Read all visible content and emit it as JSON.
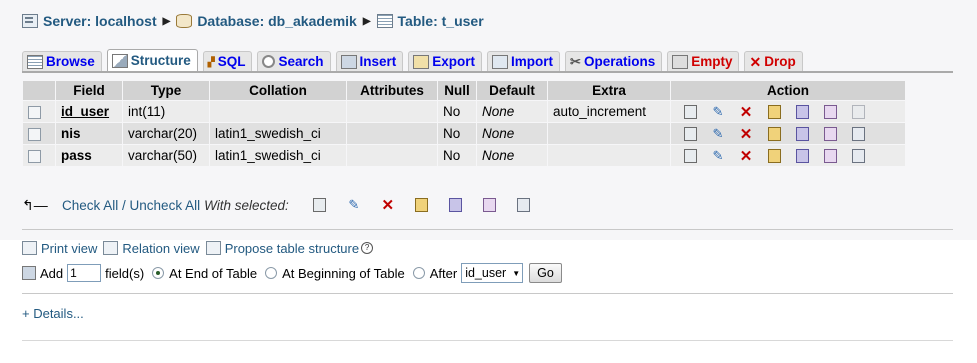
{
  "breadcrumb": {
    "server_label": "Server: localhost",
    "database_label": "Database: db_akademik",
    "table_label": "Table: t_user",
    "separator": "▶"
  },
  "tabs": [
    {
      "label": "Browse",
      "icon": "browse-icon"
    },
    {
      "label": "Structure",
      "icon": "structure-icon",
      "active": true
    },
    {
      "label": "SQL",
      "icon": "sql-icon"
    },
    {
      "label": "Search",
      "icon": "search-icon"
    },
    {
      "label": "Insert",
      "icon": "insert-icon"
    },
    {
      "label": "Export",
      "icon": "export-icon"
    },
    {
      "label": "Import",
      "icon": "import-icon"
    },
    {
      "label": "Operations",
      "icon": "operations-icon"
    },
    {
      "label": "Empty",
      "icon": "empty-icon"
    },
    {
      "label": "Drop",
      "icon": "drop-icon"
    }
  ],
  "columns": [
    "Field",
    "Type",
    "Collation",
    "Attributes",
    "Null",
    "Default",
    "Extra",
    "Action"
  ],
  "rows": [
    {
      "field": "id_user",
      "type": "int(11)",
      "collation": "",
      "attributes": "",
      "null": "No",
      "default": "None",
      "extra": "auto_increment"
    },
    {
      "field": "nis",
      "type": "varchar(20)",
      "collation": "latin1_swedish_ci",
      "attributes": "",
      "null": "No",
      "default": "None",
      "extra": ""
    },
    {
      "field": "pass",
      "type": "varchar(50)",
      "collation": "latin1_swedish_ci",
      "attributes": "",
      "null": "No",
      "default": "None",
      "extra": ""
    }
  ],
  "check_all": {
    "check_all": "Check All",
    "slash": " / ",
    "uncheck_all": "Uncheck All",
    "with_selected": "With selected:"
  },
  "links": {
    "print_view": "Print view",
    "relation_view": "Relation view",
    "propose": "Propose table structure"
  },
  "add_fields": {
    "add": "Add",
    "count": "1",
    "fields_label": "field(s)",
    "at_end": "At End of Table",
    "at_beginning": "At Beginning of Table",
    "after": "After",
    "after_select": "id_user",
    "go": "Go"
  },
  "details": "+ Details..."
}
